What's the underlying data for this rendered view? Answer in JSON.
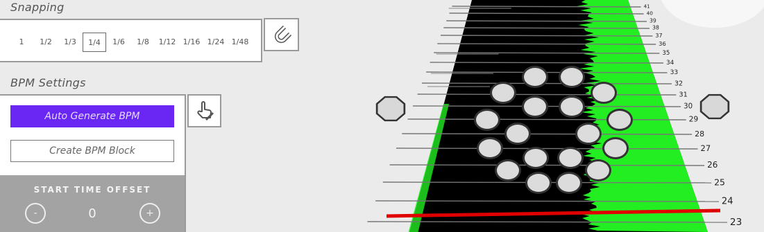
{
  "snapping": {
    "title": "Snapping",
    "options": [
      "1",
      "1/2",
      "1/3",
      "1/4",
      "1/6",
      "1/8",
      "1/12",
      "1/16",
      "1/24",
      "1/48"
    ],
    "selected": "1/4",
    "magnet_icon": "magnet-icon"
  },
  "bpm": {
    "title": "BPM Settings",
    "auto_generate_label": "Auto Generate BPM",
    "create_block_label": "Create BPM Block",
    "hand_icon": "hand-pointer-icon",
    "start_offset_label": "START TIME OFFSET",
    "start_offset_value": "0",
    "minus_label": "-",
    "plus_label": "+"
  },
  "track": {
    "beat_numbers": [
      "23",
      "24",
      "25",
      "26",
      "27",
      "28",
      "29",
      "30",
      "31",
      "32",
      "33",
      "34",
      "35",
      "36",
      "37",
      "38",
      "39",
      "40",
      "41"
    ],
    "colors": {
      "lane": "#000000",
      "waveform": "#22ee22",
      "playhead": "#e00000",
      "accent": "#6a26f2"
    }
  }
}
